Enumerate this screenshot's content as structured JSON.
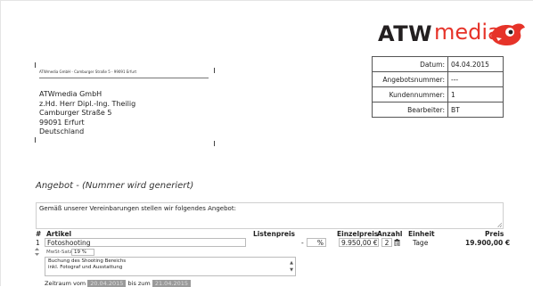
{
  "logo": {
    "part1": "ATW",
    "part2": "media"
  },
  "sender": {
    "line": "ATWmedia GmbH - Camburger Straße 5 - 99091 Erfurt",
    "address": [
      "ATWmedia GmbH",
      "z.Hd. Herr Dipl.-Ing. Theilig",
      "Camburger Straße 5",
      "99091 Erfurt",
      "Deutschland"
    ]
  },
  "info": {
    "rows": [
      {
        "label": "Datum:",
        "value": "04.04.2015"
      },
      {
        "label": "Angebotsnummer:",
        "value": "---"
      },
      {
        "label": "Kundennummer:",
        "value": "1"
      },
      {
        "label": "Bearbeiter:",
        "value": "BT"
      }
    ]
  },
  "offer": {
    "title": "Angebot - (Nummer wird generiert)",
    "intro": "Gemäß unserer Vereinbarungen stellen wir folgendes Angebot:"
  },
  "table": {
    "headers": {
      "num": "#",
      "article": "Artikel",
      "list_price": "Listenpreis",
      "unit_price": "Einzelpreis",
      "qty": "Anzahl",
      "unit": "Einheit",
      "price": "Preis"
    },
    "rows": [
      {
        "num": "1",
        "article": "Fotoshooting",
        "list_price": "-",
        "percent": "%",
        "unit_price": "9.950,00 €",
        "qty": "2",
        "unit": "Tage",
        "price": "19.900,00 €",
        "vat_label": "MwSt-Satz:",
        "vat_value": "19 %",
        "description": [
          "Buchung des Shooting Bereichs",
          "inkl. Fotograf und Ausstattung"
        ],
        "period_from_label": "Zeitraum vom",
        "period_from": "20.04.2015",
        "period_to_label": "bis zum",
        "period_to": "21.04.2015"
      }
    ]
  }
}
